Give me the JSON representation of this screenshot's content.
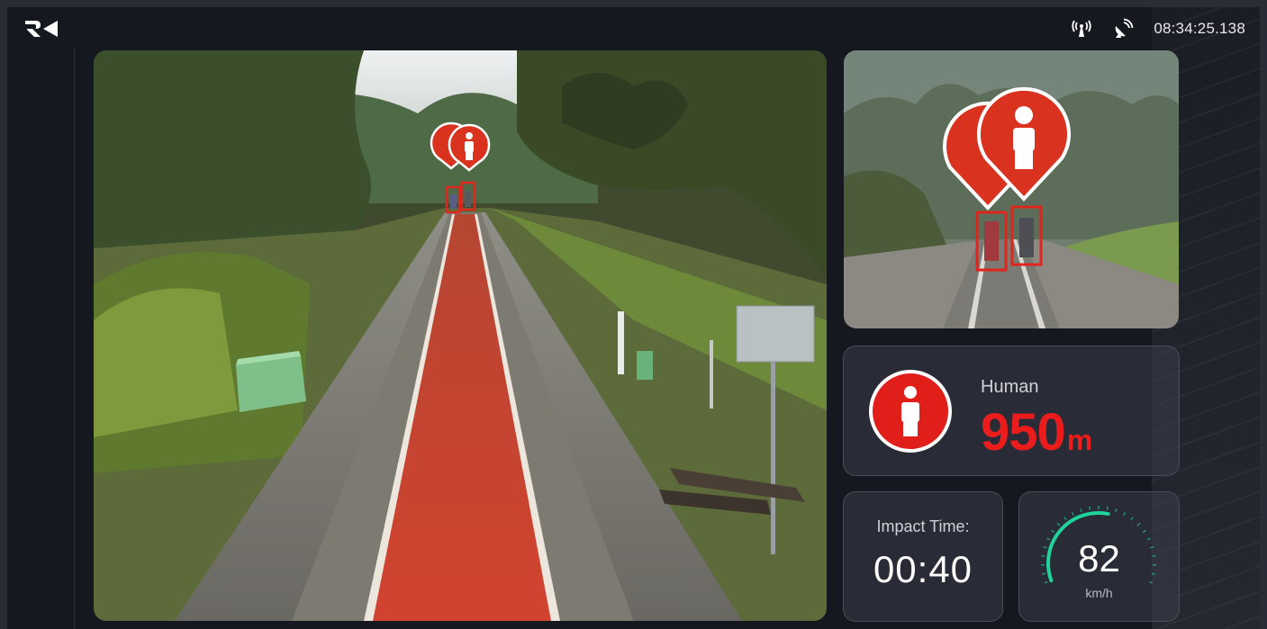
{
  "header": {
    "clock": "08:34:25.138",
    "logo_icon": "r4-logo",
    "status_icons": [
      "broadcast-antenna-icon",
      "satellite-dish-icon"
    ]
  },
  "main_camera": {
    "track_highlight_color": "#d6402c",
    "detections": [
      {
        "label": "human",
        "box_color": "#e0261c"
      },
      {
        "label": "human",
        "box_color": "#e0261c"
      }
    ]
  },
  "zoom_camera": {
    "detections": [
      {
        "label": "human",
        "box_color": "#e0261c"
      },
      {
        "label": "human",
        "box_color": "#e0261c"
      }
    ]
  },
  "detection": {
    "label": "Human",
    "distance": "950",
    "unit": "m",
    "color": "#ea1c1c",
    "icon": "person-marker-icon"
  },
  "impact": {
    "label": "Impact Time:",
    "time": "00:40"
  },
  "speed": {
    "value": "82",
    "unit": "km/h",
    "gauge_color": "#1fd39a",
    "fraction": 0.55
  }
}
